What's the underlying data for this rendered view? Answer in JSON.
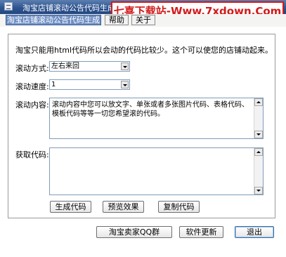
{
  "window": {
    "title": "淘宝店铺滚动公告代码生成器",
    "watermark": "七喜下载站-Www.7xdown.Com"
  },
  "menu": {
    "tab_main": "淘宝店铺滚动公告代码生成器",
    "help": "帮助",
    "about": "关于"
  },
  "form": {
    "intro": "淘宝只能用html代码所以会动的代码比较少。这个可以使您的店铺动起来。",
    "direction_label": "滚动方式:",
    "direction_value": "左右来回",
    "speed_label": "滚动速度:",
    "speed_value": "1",
    "content_label": "滚动内容:",
    "content_text": "滚动内容中您可以放文字、单张或者多张图片代码、表格代码、模板代码等等一切您希望滚的代码。",
    "output_label": "获取代码:",
    "output_text": ""
  },
  "actions": {
    "generate": "生成代码",
    "preview": "预览效果",
    "copy": "复制代码",
    "qq_group": "淘宝卖家QQ群",
    "update": "软件更新",
    "exit": "退出"
  }
}
